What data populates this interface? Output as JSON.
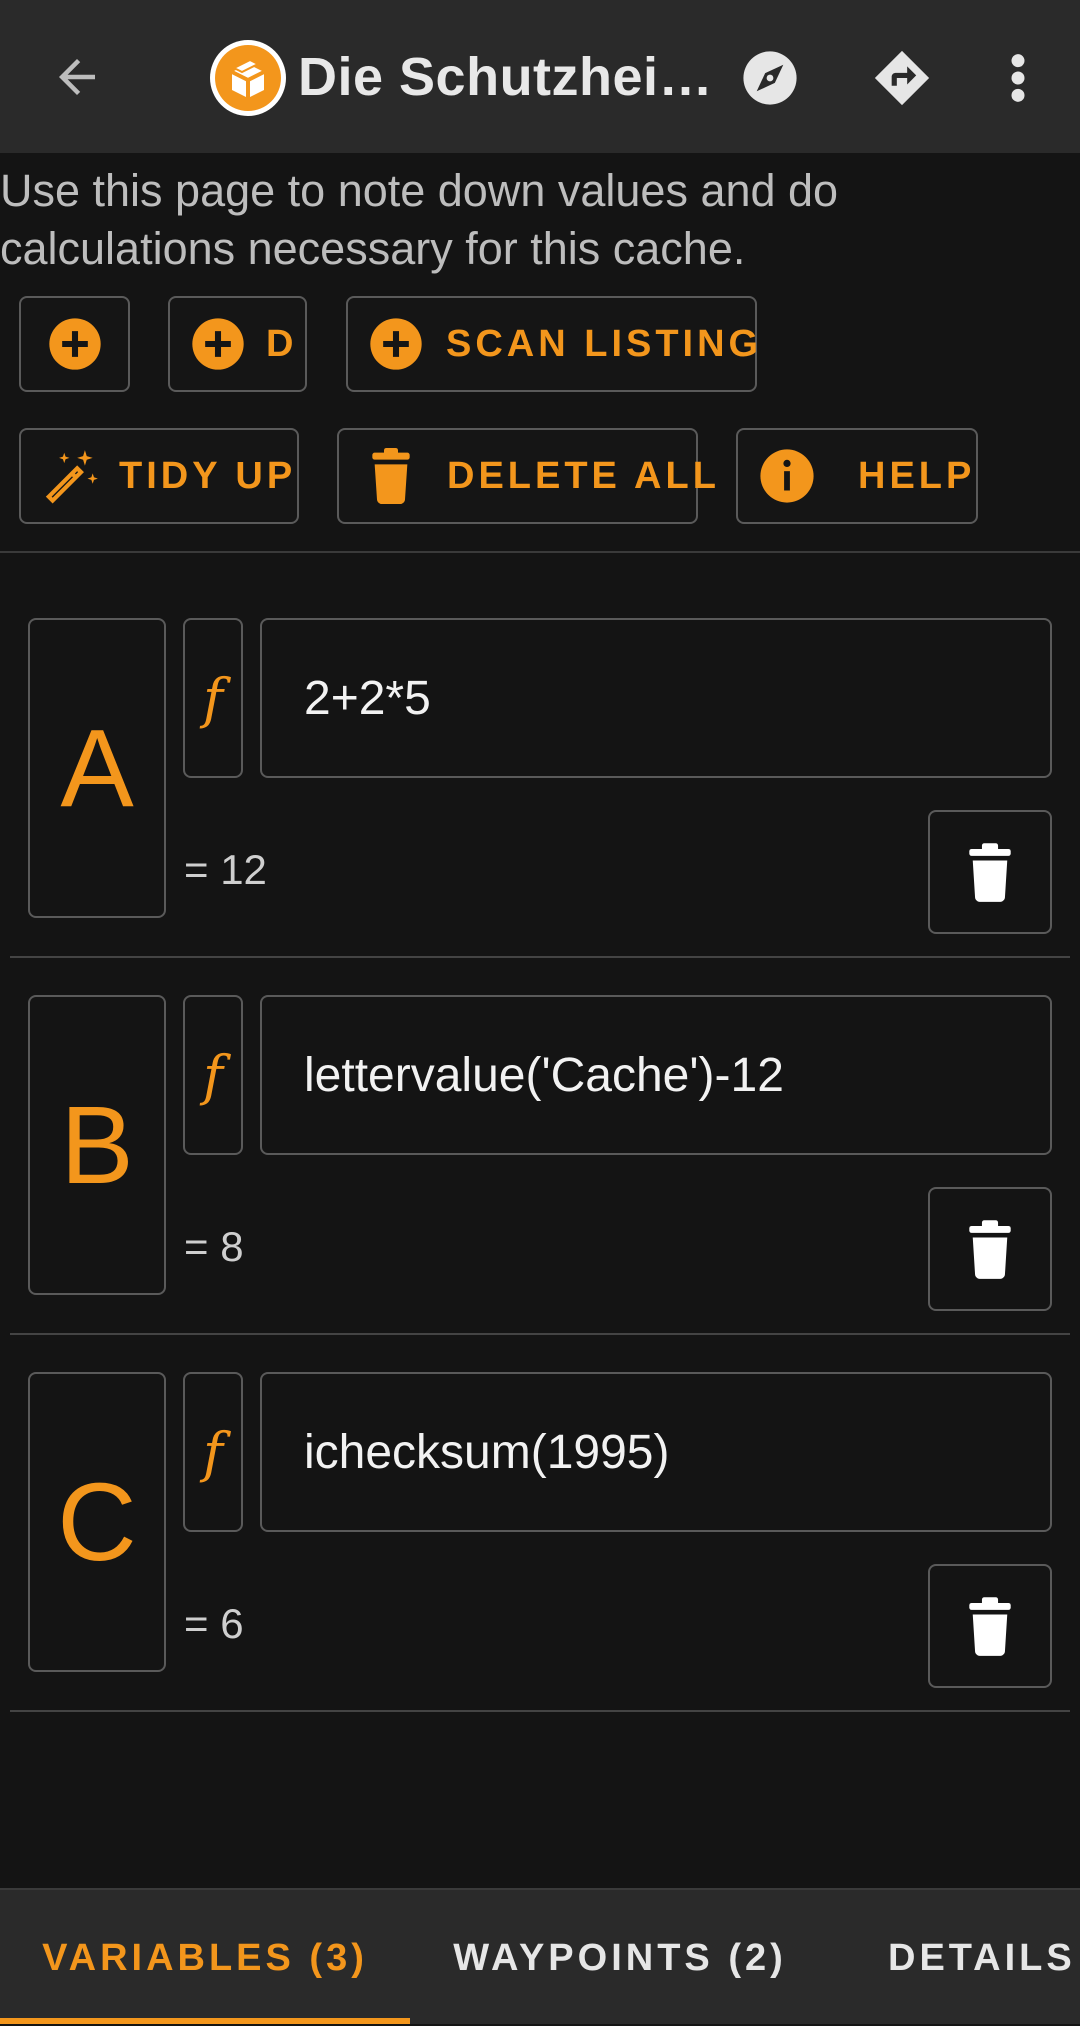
{
  "colors": {
    "accent": "#f3961c",
    "background": "#141414",
    "bar": "#2a2a2a"
  },
  "header": {
    "title": "Die Schutzhei…",
    "back_icon": "arrow-left-icon",
    "cache_icon": "cache-type-icon",
    "compass_icon": "compass-icon",
    "navigate_icon": "directions-icon",
    "menu_icon": "more-vert-icon"
  },
  "intro": "Use this page to note down values and do calculations necessary for this cache.",
  "actions": {
    "add_label": "",
    "add_d_label": "D",
    "scan_label": "SCAN LISTING",
    "tidy_label": "TIDY UP",
    "delete_all_label": "DELETE ALL",
    "help_label": "HELP"
  },
  "variables": [
    {
      "letter": "A",
      "f": "f",
      "formula": "2+2*5",
      "result": "= 12"
    },
    {
      "letter": "B",
      "f": "f",
      "formula": "lettervalue('Cache')-12",
      "result": "= 8"
    },
    {
      "letter": "C",
      "f": "f",
      "formula": "ichecksum(1995)",
      "result": "= 6"
    }
  ],
  "tabs": [
    {
      "label": "VARIABLES (3)",
      "selected": true
    },
    {
      "label": "WAYPOINTS (2)",
      "selected": false
    },
    {
      "label": "DETAILS",
      "selected": false
    }
  ]
}
